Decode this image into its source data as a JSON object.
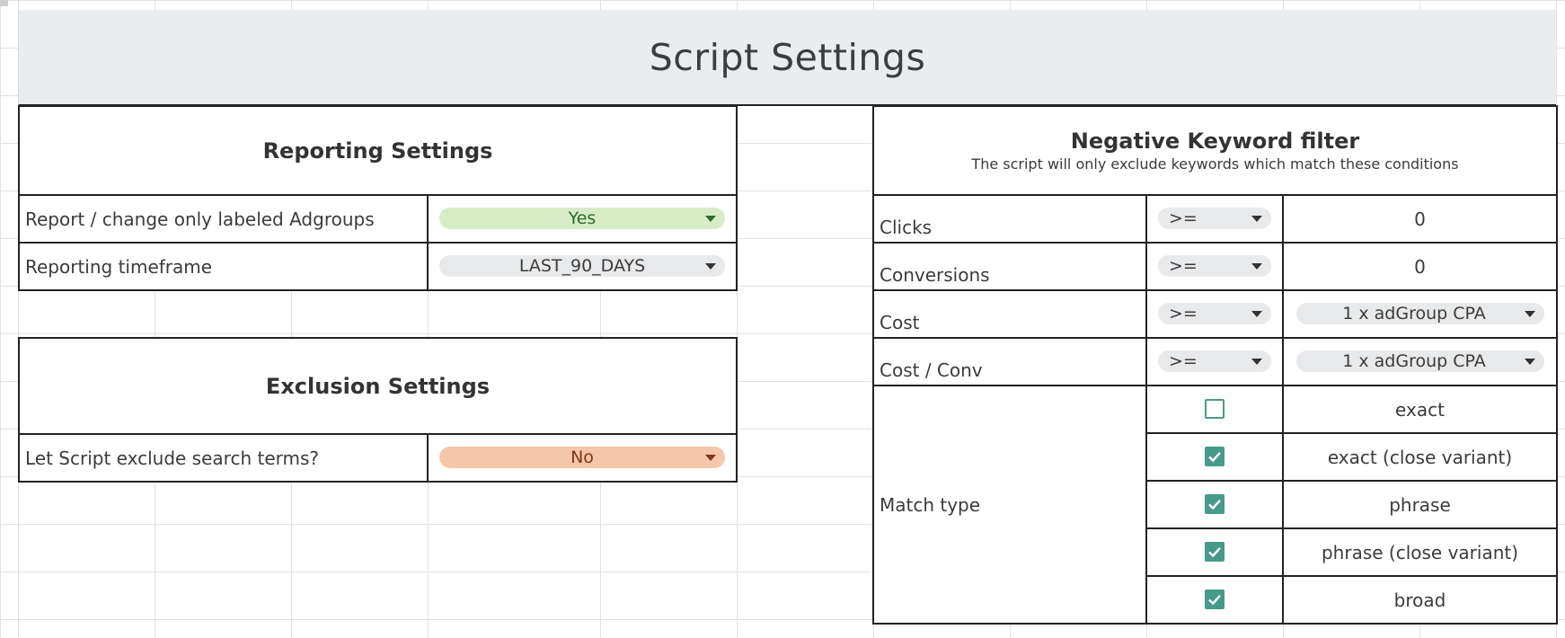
{
  "title": "Script Settings",
  "reporting": {
    "header": "Reporting Settings",
    "rows": [
      {
        "label": "Report / change only labeled Adgroups",
        "value": "Yes"
      },
      {
        "label": "Reporting timeframe",
        "value": "LAST_90_DAYS"
      }
    ]
  },
  "exclusion": {
    "header": "Exclusion Settings",
    "rows": [
      {
        "label": "Let Script exclude search terms?",
        "value": "No"
      }
    ]
  },
  "negative": {
    "header": "Negative Keyword filter",
    "subtitle": "The script will only exclude keywords which match these conditions",
    "conditions": [
      {
        "label": "Clicks",
        "operator": ">=",
        "value": "0"
      },
      {
        "label": "Conversions",
        "operator": ">=",
        "value": "0"
      },
      {
        "label": "Cost",
        "operator": ">=",
        "value": "1 x adGroup CPA"
      },
      {
        "label": "Cost / Conv",
        "operator": ">=",
        "value": "1 x adGroup CPA"
      }
    ],
    "match_type": {
      "label": "Match type",
      "options": [
        {
          "name": "exact",
          "checked": false
        },
        {
          "name": "exact (close variant)",
          "checked": true
        },
        {
          "name": "phrase",
          "checked": true
        },
        {
          "name": "phrase (close variant)",
          "checked": true
        },
        {
          "name": "broad",
          "checked": true
        }
      ]
    }
  },
  "colors": {
    "title_bg": "#eaedf0",
    "yes_pill": "#d7ecc6",
    "no_pill": "#f6c6ab",
    "checkbox": "#479989"
  }
}
